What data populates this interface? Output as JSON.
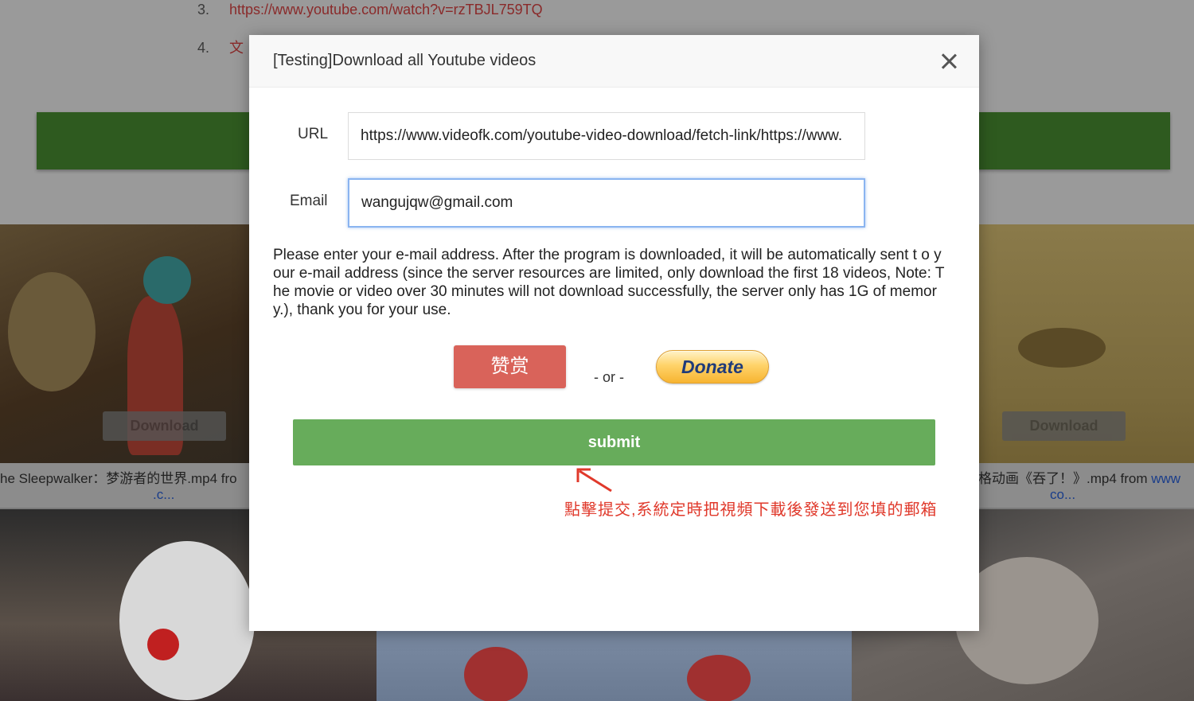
{
  "background": {
    "list": [
      {
        "num": "3.",
        "text": "https://www.youtube.com/watch?v=rzTBJL759TQ"
      },
      {
        "num": "4.",
        "text": "文"
      }
    ],
    "cards": [
      {
        "download_label": "Download",
        "caption_line1": "he Sleepwalker：梦游者的世界.mp4 fro",
        "caption_line2": ".c..."
      },
      {
        "download_label": "Download",
        "caption_line1_a": "格动画《吞了！》.mp4 from ",
        "caption_line1_b": "www",
        "caption_line2": "co..."
      }
    ]
  },
  "modal": {
    "title": "[Testing]Download all Youtube videos",
    "url_label": "URL",
    "url_value": "https://www.videofk.com/youtube-video-download/fetch-link/https://www.",
    "email_label": "Email",
    "email_value": "wangujqw@gmail.com",
    "notice": "Please enter your e-mail address. After the program is downloaded, it will be automatically sent t o your e-mail address (since the server resources are limited, only download the first 18 videos, Note: The movie or video over 30 minutes will not download successfully, the server only has 1G of memory.), thank you for your use.",
    "reward_label": "赞赏",
    "or_label": "- or -",
    "donate_label": "Donate",
    "submit_label": "submit"
  },
  "annotation": {
    "note": "點擊提交,系統定時把視頻下載後發送到您填的郵箱",
    "color": "#e0392b"
  },
  "colors": {
    "submit": "#67ac5b",
    "reward": "#d9635a",
    "focus_border": "#8ab4f0"
  }
}
